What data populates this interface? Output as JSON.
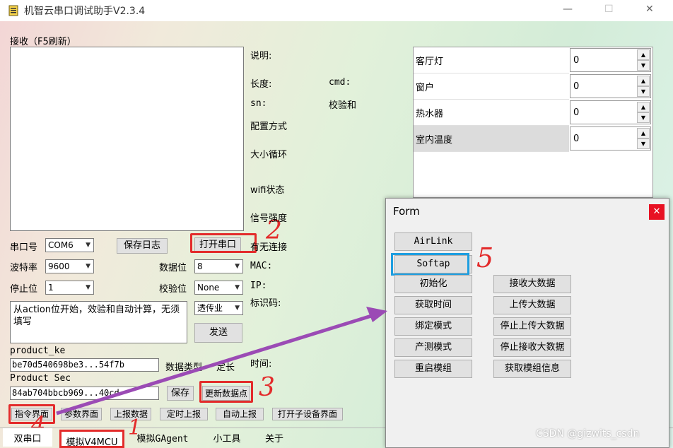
{
  "window": {
    "title": "机智云串口调试助手V2.3.4",
    "minimize": "—",
    "maximize": "☐",
    "close": "✕"
  },
  "receive": {
    "label": "接收（F5刷新）",
    "content": ""
  },
  "serial": {
    "port_label": "串口号",
    "port_value": "COM6",
    "save_log": "保存日志",
    "open_port": "打开串口",
    "baud_label": "波特率",
    "baud_value": "9600",
    "databits_label": "数据位",
    "databits_value": "8",
    "stopbits_label": "停止位",
    "stopbits_value": "1",
    "parity_label": "校验位",
    "parity_value": "None"
  },
  "send": {
    "text": "从action位开始，效验和自动计算，无须填写",
    "mode": "透传业",
    "send_button": "发送"
  },
  "product": {
    "key_label": "product_ke",
    "key_value": "be70d540698be3...54f7b",
    "datatype_label": "数据类型",
    "datatype_value": "定长",
    "secret_label": "Product Sec",
    "secret_value": "84ab704bbcb969...40cd",
    "save": "保存",
    "update_datapoint": "更新数据点"
  },
  "toolbar": {
    "cmd_ui": "指令界面",
    "param_ui": "参数界面",
    "report_data": "上报数据",
    "timed_report": "定时上报",
    "auto_report": "自动上报",
    "subdevice_ui": "打开子设备界面"
  },
  "info": {
    "desc": "说明:",
    "length": "长度:",
    "cmd": "cmd:",
    "sn": "sn:",
    "checksum": "校验和",
    "config_mode": "配置方式",
    "size_loop": "大小循环",
    "wifi_status": "wifi状态",
    "signal": "信号强度",
    "connected": "有无连接",
    "mac": "MAC:",
    "ip": "IP:",
    "ident": "标识码:",
    "time": "时间:"
  },
  "datapoints": [
    {
      "name": "客厅灯",
      "value": "0"
    },
    {
      "name": "窗户",
      "value": "0"
    },
    {
      "name": "热水器",
      "value": "0"
    },
    {
      "name": "室内温度",
      "value": "0"
    }
  ],
  "tabs": [
    "双串口",
    "模拟V4MCU",
    "模拟GAgent",
    "小工具",
    "关于"
  ],
  "form": {
    "title": "Form",
    "left_buttons": [
      "AirLink",
      "Softap",
      "初始化",
      "获取时间",
      "绑定模式",
      "产测模式",
      "重启模组"
    ],
    "right_buttons": [
      "接收大数据",
      "上传大数据",
      "停止上传大数据",
      "停止接收大数据",
      "获取模组信息"
    ]
  },
  "annotations": [
    "1",
    "2",
    "3",
    "4",
    "5"
  ],
  "watermark": "CSDN @gizwits_csdn",
  "colors": {
    "annotation_red": "#e32b2b",
    "highlight_blue": "#1e9ee0",
    "arrow_purple": "#9b4bb5",
    "close_red": "#e81123"
  }
}
